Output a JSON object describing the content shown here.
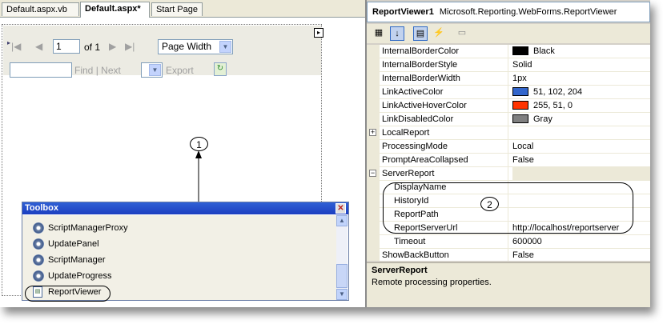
{
  "tabs": [
    {
      "label": "Default.aspx.vb",
      "active": false
    },
    {
      "label": "Default.aspx*",
      "active": true
    },
    {
      "label": "Start Page",
      "active": false
    }
  ],
  "reportviewer_toolbar": {
    "page_value": "1",
    "of_text": "of 1",
    "zoom_value": "Page Width",
    "find_label": "Find",
    "separator": "|",
    "next_label": "Next",
    "export_label": "Export"
  },
  "callouts": {
    "one": "1",
    "two": "2"
  },
  "toolbox": {
    "title": "Toolbox",
    "items": [
      {
        "label": "ScriptManagerProxy",
        "icon": "gear-icon"
      },
      {
        "label": "UpdatePanel",
        "icon": "gear-icon"
      },
      {
        "label": "ScriptManager",
        "icon": "gear-icon"
      },
      {
        "label": "UpdateProgress",
        "icon": "gear-icon"
      },
      {
        "label": "ReportViewer",
        "icon": "report-icon"
      }
    ]
  },
  "properties": {
    "object_name": "ReportViewer1",
    "object_type": "Microsoft.Reporting.WebForms.ReportViewer",
    "rows": [
      {
        "name": "InternalBorderColor",
        "value": "Black",
        "swatch": "#000000"
      },
      {
        "name": "InternalBorderStyle",
        "value": "Solid"
      },
      {
        "name": "InternalBorderWidth",
        "value": "1px"
      },
      {
        "name": "LinkActiveColor",
        "value": "51, 102, 204",
        "swatch": "#3366cc"
      },
      {
        "name": "LinkActiveHoverColor",
        "value": "255, 51, 0",
        "swatch": "#ff3300"
      },
      {
        "name": "LinkDisabledColor",
        "value": "Gray",
        "swatch": "#808080"
      },
      {
        "name": "LocalReport",
        "value": "",
        "expander": "+"
      },
      {
        "name": "ProcessingMode",
        "value": "Local"
      },
      {
        "name": "PromptAreaCollapsed",
        "value": "False"
      },
      {
        "name": "ServerReport",
        "value": "",
        "expander": "−"
      },
      {
        "name": "DisplayName",
        "value": "",
        "sub": true
      },
      {
        "name": "HistoryId",
        "value": "",
        "sub": true
      },
      {
        "name": "ReportPath",
        "value": "",
        "sub": true
      },
      {
        "name": "ReportServerUrl",
        "value": "http://localhost/reportserver",
        "sub": true
      },
      {
        "name": "Timeout",
        "value": "600000",
        "sub": true
      },
      {
        "name": "ShowBackButton",
        "value": "False"
      }
    ],
    "description_title": "ServerReport",
    "description_text": "Remote processing properties."
  }
}
